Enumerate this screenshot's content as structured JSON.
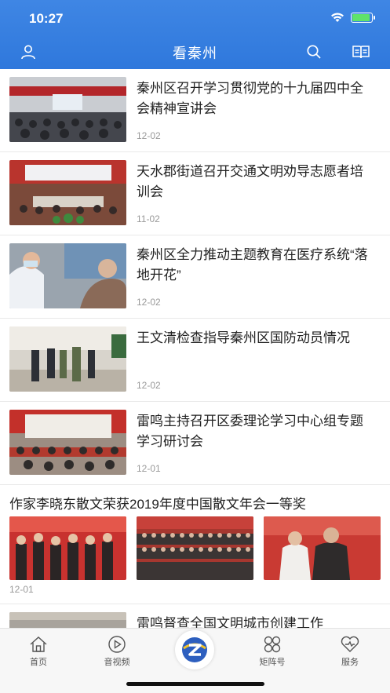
{
  "status_bar": {
    "time": "10:27"
  },
  "nav": {
    "title": "看秦州",
    "icons": [
      "user-icon",
      "search-icon",
      "reader-icon"
    ]
  },
  "feed": {
    "items": [
      {
        "title": "秦州区召开学习贯彻党的十九届四中全会精神宣讲会",
        "date": "12-02"
      },
      {
        "title": "天水郡街道召开交通文明劝导志愿者培训会",
        "date": "11-02"
      },
      {
        "title": "秦州区全力推动主题教育在医疗系统“落地开花”",
        "date": "12-02"
      },
      {
        "title": "王文清检查指导秦州区国防动员情况",
        "date": "12-02"
      },
      {
        "title": "雷鸣主持召开区委理论学习中心组专题学习研讨会",
        "date": "12-01"
      }
    ],
    "gallery": {
      "title": "作家李晓东散文荣获2019年度中国散文年会一等奖",
      "date": "12-01"
    },
    "partial_item": {
      "title": "雷鸣督查全国文明城市创建工作"
    }
  },
  "tabbar": {
    "tabs": [
      {
        "label": "首页",
        "icon": "home-icon"
      },
      {
        "label": "音视频",
        "icon": "play-icon"
      },
      {
        "label": "",
        "icon": "app-logo-icon"
      },
      {
        "label": "矩阵号",
        "icon": "matrix-icon"
      },
      {
        "label": "服务",
        "icon": "heart-icon"
      }
    ]
  },
  "colors": {
    "header": "#3f86e4",
    "battery": "#5fe36a",
    "text": "#222222",
    "date": "#999999"
  }
}
